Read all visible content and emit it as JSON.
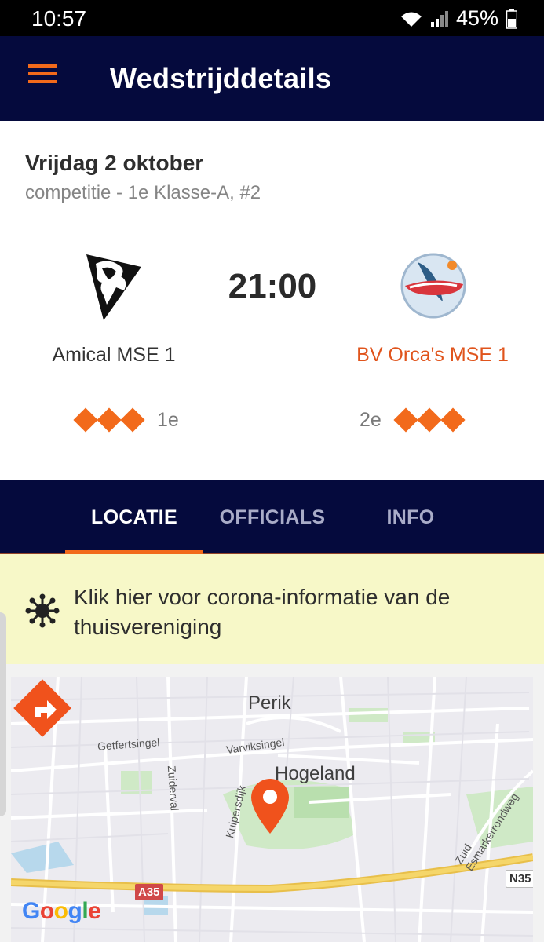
{
  "status_bar": {
    "time": "10:57",
    "battery": "45%"
  },
  "app_bar": {
    "title": "Wedstrijddetails",
    "menu_icon": "hamburger-menu-icon"
  },
  "match": {
    "date": "Vrijdag 2 oktober",
    "subtitle": "competitie - 1e Klasse-A, #2",
    "time": "21:00",
    "home": {
      "name": "Amical MSE 1",
      "rank": "1e",
      "rating": 3
    },
    "away": {
      "name": "BV Orca's MSE 1",
      "rank": "2e",
      "rating": 3
    }
  },
  "tabs": [
    {
      "label": "LOCATIE"
    },
    {
      "label": "OFFICIALS"
    },
    {
      "label": "INFO"
    }
  ],
  "corona_banner": {
    "text": "Klik hier voor corona-informatie van de thuisvereniging"
  },
  "map": {
    "labels": {
      "perik": "Perik",
      "hogeland": "Hogeland",
      "getfertsingel": "Getfertsingel",
      "varviksingel": "Varviksingel",
      "zuiderval": "Zuiderval",
      "kuipersdijk": "Kuipersdijk",
      "zuid_esmarkerrondweg": "Zuid Esmarkerrondweg",
      "a35": "A35",
      "n35": "N35"
    },
    "attribution": "Google",
    "colors": {
      "pin": "#f0521c",
      "highway": "#f5d66a",
      "park": "#cfe9c6"
    }
  },
  "colors": {
    "navy": "#050a3d",
    "accent": "#f26a1b",
    "banner": "#f7f8c8"
  }
}
